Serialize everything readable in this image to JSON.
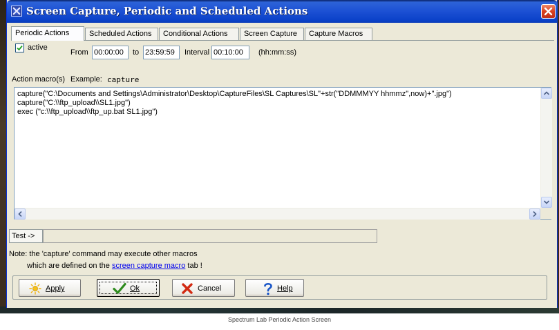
{
  "window": {
    "title": "Screen Capture, Periodic and Scheduled Actions"
  },
  "tabs": [
    {
      "label": "Periodic Actions",
      "active": true
    },
    {
      "label": "Scheduled Actions",
      "active": false
    },
    {
      "label": "Conditional Actions",
      "active": false
    },
    {
      "label": "Screen Capture",
      "active": false
    },
    {
      "label": "Capture Macros",
      "active": false
    }
  ],
  "periodic": {
    "active_label": "active",
    "active_checked": true,
    "from_label": "From",
    "from_value": "00:00:00",
    "to_label": "to",
    "to_value": "23:59:59",
    "interval_label": "Interval",
    "interval_value": "00:10:00",
    "format_hint": "(hh:mm:ss)"
  },
  "macros": {
    "label": "Action macro(s)",
    "example_label": "Example:",
    "example_value": "capture",
    "lines": [
      "capture(\"C:\\Documents and Settings\\Administrator\\Desktop\\CaptureFiles\\SL Captures\\SL\"+str(\"DDMMMYY hhmmz\",now)+\".jpg\")",
      "capture(\"C:\\\\ftp_upload\\\\SL1.jpg\")",
      "exec (\"c:\\\\ftp_upload\\\\ftp_up.bat SL1.jpg\")"
    ]
  },
  "test": {
    "button_label": "Test ->",
    "field_value": ""
  },
  "note": {
    "line1": "Note: the 'capture' command  may  execute other macros",
    "line2_prefix": "which are defined on the",
    "link_text": "screen capture macro",
    "line2_suffix": "tab !"
  },
  "buttons": {
    "apply": "Apply",
    "ok": "Ok",
    "cancel": "Cancel",
    "help": "Help"
  },
  "colors": {
    "titlebar": "#1c50d4",
    "window_bg": "#ece9d8",
    "link": "#0000ee",
    "ok_check": "#2e8b1e",
    "cancel_x": "#d22a12",
    "help_q": "#1a56c8"
  },
  "icons": {
    "app": "app-icon",
    "close": "close-icon",
    "apply": "sun-icon",
    "ok": "checkmark-icon",
    "cancel": "x-icon",
    "help": "question-icon"
  },
  "caption": "Spectrum Lab Periodic Action Screen"
}
